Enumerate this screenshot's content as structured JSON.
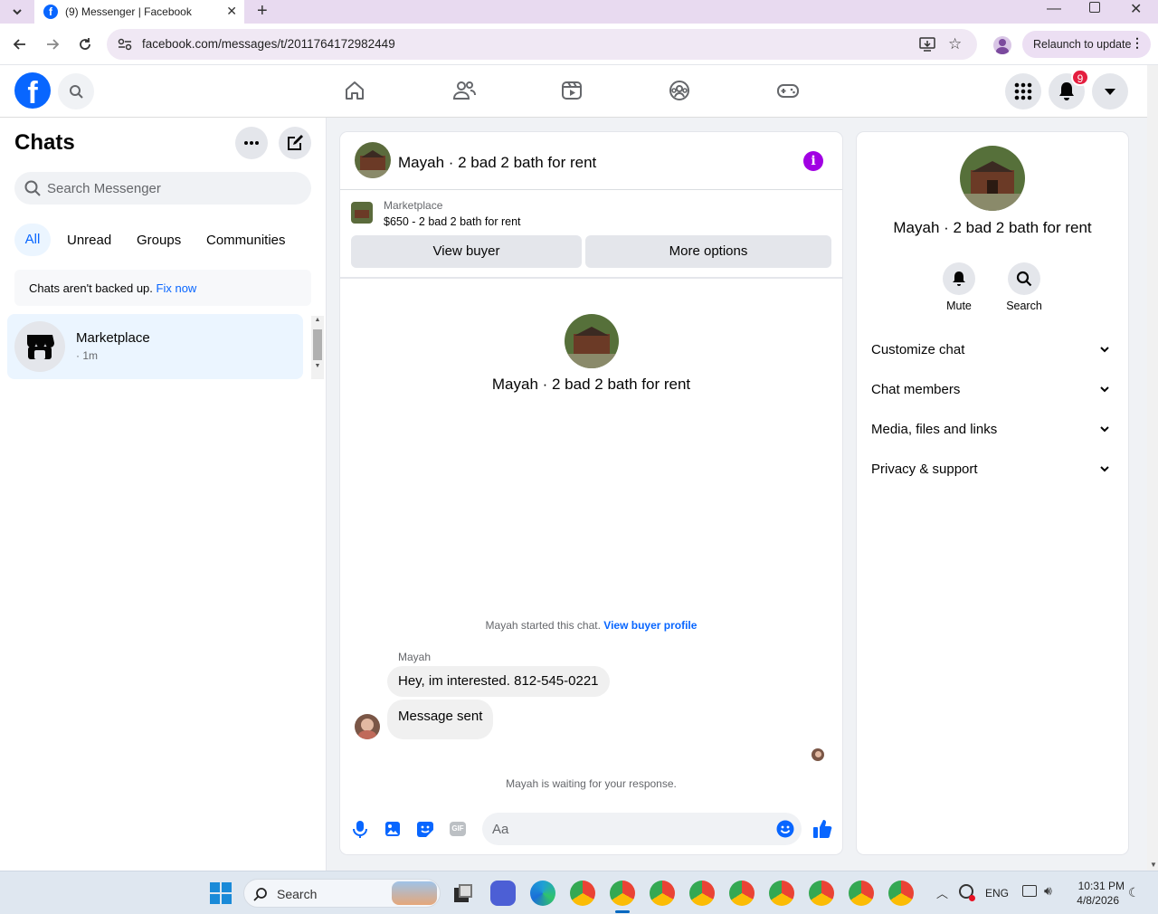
{
  "browser": {
    "tab_title": "(9) Messenger | Facebook",
    "url": "facebook.com/messages/t/2011764172982449",
    "relaunch_label": "Relaunch to update"
  },
  "fb_header": {
    "notification_count": "9",
    "nav_icons": [
      "home-icon",
      "friends-icon",
      "watch-icon",
      "groups-icon",
      "gaming-icon"
    ],
    "brand_color": "#0866ff"
  },
  "sidebar": {
    "title": "Chats",
    "search_placeholder": "Search Messenger",
    "filters": [
      "All",
      "Unread",
      "Groups",
      "Communities"
    ],
    "backup_notice": "Chats aren't backed up.",
    "backup_link": "Fix now",
    "chats": [
      {
        "name": "Marketplace",
        "meta": "· 1m"
      }
    ]
  },
  "conversation": {
    "title": "Mayah · 2 bad 2 bath for rent",
    "listing_source": "Marketplace",
    "listing_summary": "$650 - 2 bad 2 bath for rent",
    "view_buyer_label": "View buyer",
    "more_options_label": "More options",
    "profile_name": "Mayah · 2 bad 2 bath for rent",
    "started_text": "Mayah started this chat.",
    "view_buyer_profile": "View buyer profile",
    "sender": "Mayah",
    "messages": [
      "Hey, im interested. 812-545-0221",
      "Message sent"
    ],
    "waiting_text": "Mayah is waiting for your response.",
    "composer_placeholder": "Aa"
  },
  "details": {
    "name": "Mayah · 2 bad 2 bath for rent",
    "mute_label": "Mute",
    "search_label": "Search",
    "sections": [
      "Customize chat",
      "Chat members",
      "Media, files and links",
      "Privacy & support"
    ]
  },
  "taskbar": {
    "search_label": "Search",
    "lang": "ENG",
    "time": "10:31 PM",
    "date": "4/8/2026"
  }
}
